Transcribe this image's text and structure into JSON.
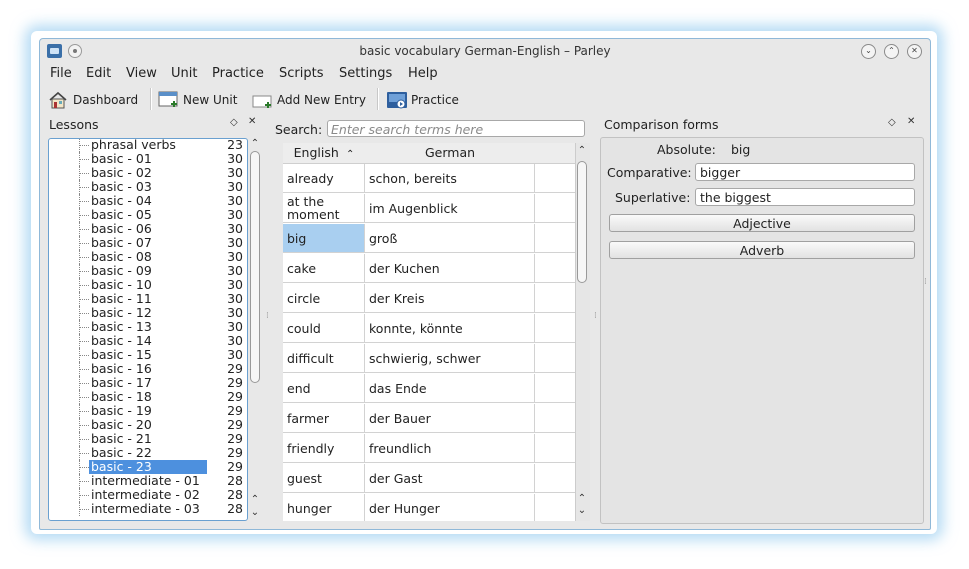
{
  "window": {
    "title": "basic vocabulary German-English – Parley"
  },
  "menu": [
    "File",
    "Edit",
    "View",
    "Unit",
    "Practice",
    "Scripts",
    "Settings",
    "Help"
  ],
  "toolbar": {
    "dashboard": "Dashboard",
    "new_unit": "New Unit",
    "add_entry": "Add New Entry",
    "practice": "Practice"
  },
  "lessons": {
    "title": "Lessons",
    "items": [
      {
        "name": "phrasal verbs",
        "count": "23"
      },
      {
        "name": "basic - 01",
        "count": "30"
      },
      {
        "name": "basic - 02",
        "count": "30"
      },
      {
        "name": "basic - 03",
        "count": "30"
      },
      {
        "name": "basic - 04",
        "count": "30"
      },
      {
        "name": "basic - 05",
        "count": "30"
      },
      {
        "name": "basic - 06",
        "count": "30"
      },
      {
        "name": "basic - 07",
        "count": "30"
      },
      {
        "name": "basic - 08",
        "count": "30"
      },
      {
        "name": "basic - 09",
        "count": "30"
      },
      {
        "name": "basic - 10",
        "count": "30"
      },
      {
        "name": "basic - 11",
        "count": "30"
      },
      {
        "name": "basic - 12",
        "count": "30"
      },
      {
        "name": "basic - 13",
        "count": "30"
      },
      {
        "name": "basic - 14",
        "count": "30"
      },
      {
        "name": "basic - 15",
        "count": "30"
      },
      {
        "name": "basic - 16",
        "count": "29"
      },
      {
        "name": "basic - 17",
        "count": "29"
      },
      {
        "name": "basic - 18",
        "count": "29"
      },
      {
        "name": "basic - 19",
        "count": "29"
      },
      {
        "name": "basic - 20",
        "count": "29"
      },
      {
        "name": "basic - 21",
        "count": "29"
      },
      {
        "name": "basic - 22",
        "count": "29"
      },
      {
        "name": "basic - 23",
        "count": "29",
        "selected": true
      },
      {
        "name": "intermediate - 01",
        "count": "28"
      },
      {
        "name": "intermediate - 02",
        "count": "28"
      },
      {
        "name": "intermediate - 03",
        "count": "28"
      }
    ]
  },
  "search": {
    "label": "Search:",
    "placeholder": "Enter search terms here"
  },
  "table": {
    "headers": [
      "English",
      "German"
    ],
    "rows": [
      {
        "english": "already",
        "german": "schon, bereits"
      },
      {
        "english": "at the moment",
        "german": "im Augenblick"
      },
      {
        "english": "big",
        "german": "groß",
        "selected": true
      },
      {
        "english": "cake",
        "german": "der Kuchen"
      },
      {
        "english": "circle",
        "german": "der Kreis"
      },
      {
        "english": "could",
        "german": "konnte, könnte"
      },
      {
        "english": "difficult",
        "german": "schwierig, schwer"
      },
      {
        "english": "end",
        "german": "das Ende"
      },
      {
        "english": "farmer",
        "german": "der Bauer"
      },
      {
        "english": "friendly",
        "german": "freundlich"
      },
      {
        "english": "guest",
        "german": "der Gast"
      },
      {
        "english": "hunger",
        "german": "der Hunger"
      }
    ]
  },
  "comparison": {
    "title": "Comparison forms",
    "absolute_label": "Absolute:",
    "absolute_value": "big",
    "comparative_label": "Comparative:",
    "comparative_value": "bigger",
    "superlative_label": "Superlative:",
    "superlative_value": "the biggest",
    "adjective_button": "Adjective",
    "adverb_button": "Adverb"
  }
}
